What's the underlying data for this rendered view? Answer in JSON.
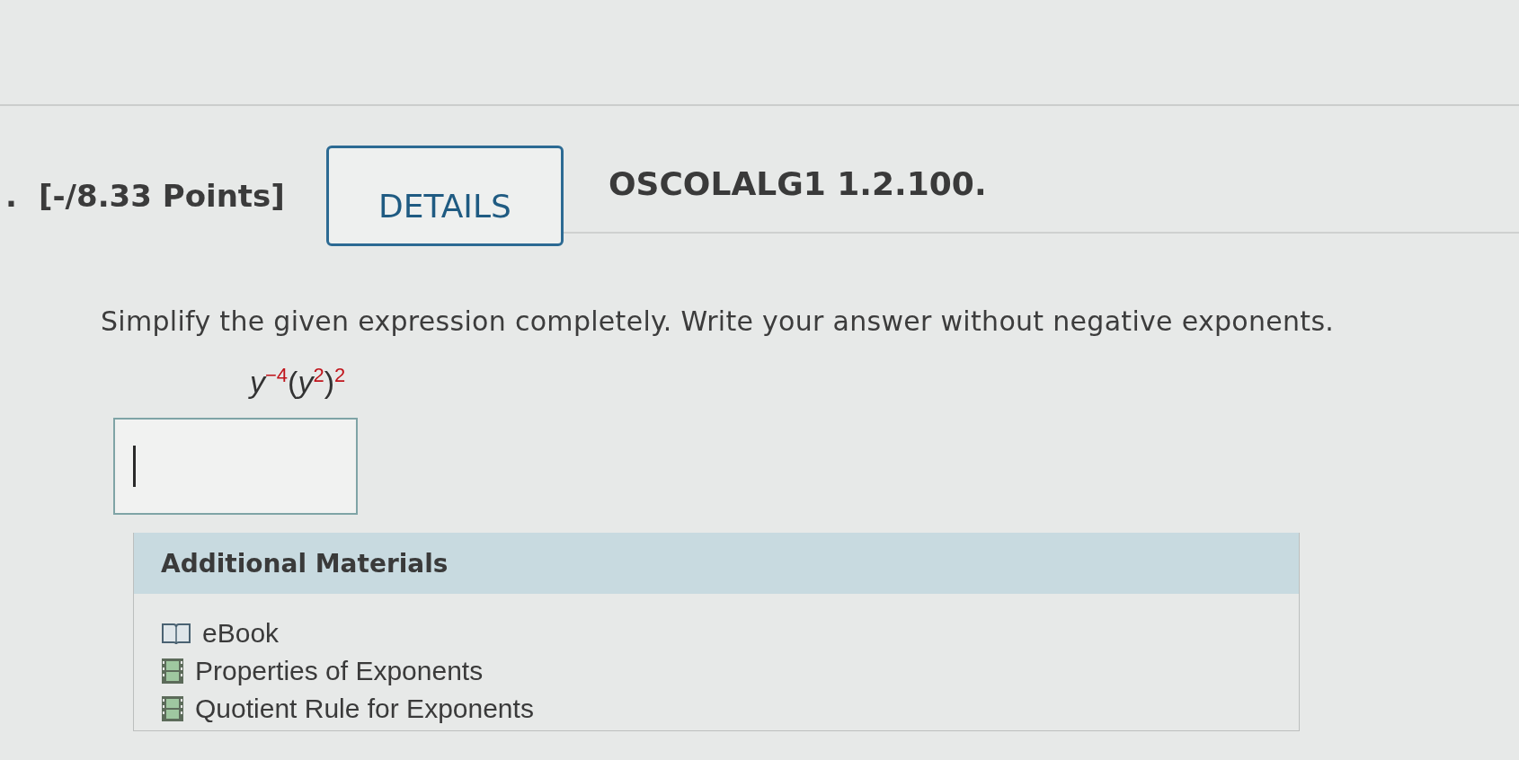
{
  "question": {
    "number": ".",
    "points": "[-/8.33 Points]",
    "details_button": "DETAILS",
    "code": "OSCOLALG1 1.2.100."
  },
  "prompt": "Simplify the given expression completely. Write your answer without negative exponents.",
  "expression": "*y*$^{−4}$(*y*$^{2}$)$^{2}$",
  "answer_box": {
    "focused": true
  },
  "additional_materials": {
    "title": "Additional Materials",
    "items": [
      {
        "kind": "ebook",
        "label": "eBook"
      },
      {
        "kind": "video",
        "label": "Properties of Exponents"
      },
      {
        "kind": "video",
        "label": "Quotient Rule for Exponents"
      }
    ]
  }
}
